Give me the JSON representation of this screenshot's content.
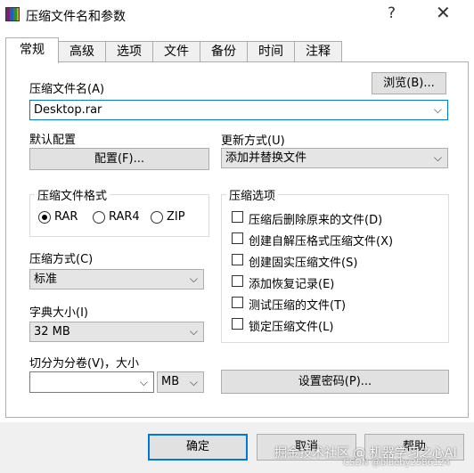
{
  "window": {
    "title": "压缩文件名和参数",
    "help_glyph": "?",
    "close_glyph": "✕"
  },
  "tabs": [
    {
      "label": "常规"
    },
    {
      "label": "高级"
    },
    {
      "label": "选项"
    },
    {
      "label": "文件"
    },
    {
      "label": "备份"
    },
    {
      "label": "时间"
    },
    {
      "label": "注释"
    }
  ],
  "archive": {
    "name_label": "压缩文件名(A)",
    "browse_label": "浏览(B)...",
    "name_value": "Desktop.rar"
  },
  "profile": {
    "label": "默认配置",
    "button_label": "配置(F)..."
  },
  "update": {
    "label": "更新方式(U)",
    "value": "添加并替换文件"
  },
  "format": {
    "group_label": "压缩文件格式",
    "options": [
      "RAR",
      "RAR4",
      "ZIP"
    ],
    "selected": "RAR"
  },
  "method": {
    "label": "压缩方式(C)",
    "value": "标准"
  },
  "dictionary": {
    "label": "字典大小(I)",
    "value": "32 MB"
  },
  "split": {
    "label": "切分为分卷(V)，大小",
    "value": "",
    "unit": "MB"
  },
  "password": {
    "button_label": "设置密码(P)..."
  },
  "options": {
    "group_label": "压缩选项",
    "items": [
      {
        "label": "压缩后删除原来的文件(D)",
        "checked": false
      },
      {
        "label": "创建自解压格式压缩文件(X)",
        "checked": false
      },
      {
        "label": "创建固实压缩文件(S)",
        "checked": false
      },
      {
        "label": "添加恢复记录(E)",
        "checked": false
      },
      {
        "label": "测试压缩的文件(T)",
        "checked": false
      },
      {
        "label": "锁定压缩文件(L)",
        "checked": false
      }
    ]
  },
  "footer": {
    "ok_label": "确定",
    "cancel_label": "取消",
    "help_label": "帮助"
  },
  "watermark": {
    "line1": "掘金技术社区 @ 机器学习之心AI",
    "line2": "CSDN @blueby2586124"
  },
  "icons": {
    "app": "winrar-books-icon",
    "dropdown": "chevron-down-icon"
  }
}
